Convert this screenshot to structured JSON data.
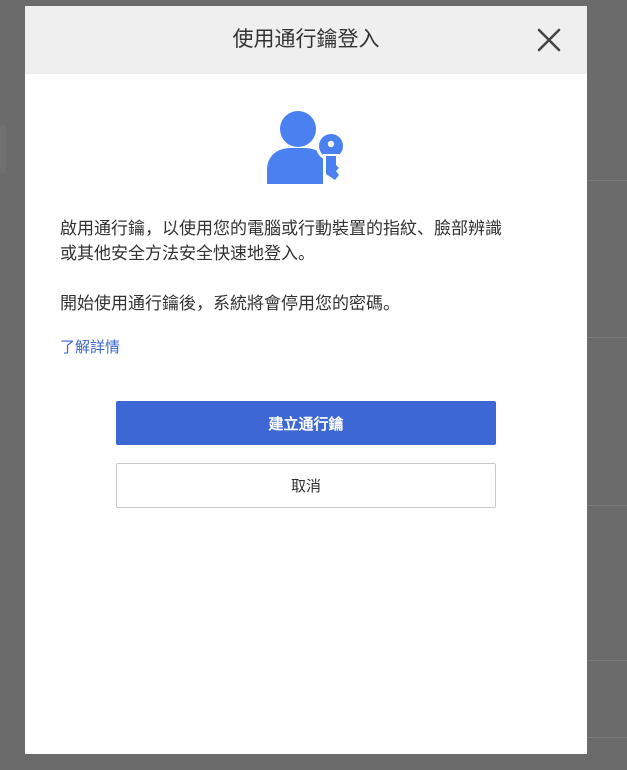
{
  "dialog": {
    "title": "使用通行鑰登入",
    "close_icon": "close-icon",
    "hero_icon": "user-key-icon",
    "description_line1": "啟用通行鑰，以使用您的電腦或行動裝置的指紋、臉部辨識",
    "description_line2": "或其他安全方法安全快速地登入。",
    "note": "開始使用通行鑰後，系統將會停用您的密碼。",
    "learn_more": "了解詳情",
    "create_button": "建立通行鑰",
    "cancel_button": "取消"
  },
  "colors": {
    "overlay": "#6b6b6b",
    "header_bg": "#efefef",
    "accent": "#3d67d5",
    "link": "#3b67c9",
    "icon": "#4a80f0"
  }
}
